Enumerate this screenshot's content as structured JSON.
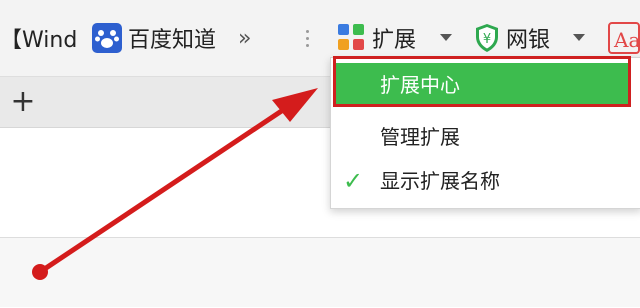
{
  "toolbar": {
    "bookmark_wind": "【Wind",
    "bookmark_baidu": "百度知道",
    "overflow_chevron": "»",
    "extensions_label": "扩展",
    "netbank_label": "网银",
    "aa_label": "Aa"
  },
  "tabs": {
    "new_tab_symbol": "+"
  },
  "extensions_menu": {
    "items": [
      {
        "label": "扩展中心",
        "highlighted": true
      },
      {
        "label": "管理扩展"
      },
      {
        "label": "显示扩展名称",
        "checked": true
      }
    ],
    "check_symbol": "✓"
  },
  "colors": {
    "menu_highlight": "#3dbc4e",
    "annotation_red": "#d41c1c",
    "baidu_blue": "#2d5fcf",
    "shield_green": "#2ea84f"
  },
  "icons": {
    "baidu": "baidu-paw-icon",
    "extensions": "extensions-grid-icon",
    "netbank": "shield-yen-icon",
    "dropdown": "caret-down-icon",
    "translate": "aa-icon"
  }
}
